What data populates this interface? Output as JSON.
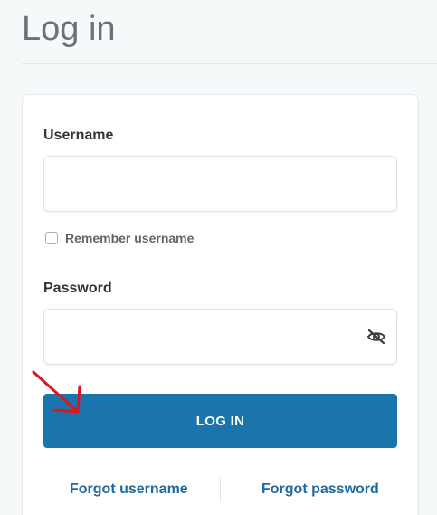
{
  "page": {
    "title": "Log in"
  },
  "form": {
    "username_label": "Username",
    "username_value": "",
    "remember_label": "Remember username",
    "remember_checked": false,
    "password_label": "Password",
    "password_value": "",
    "password_toggle_icon": "eye-slash-icon",
    "login_button_label": "LOG IN",
    "forgot_username_label": "Forgot username",
    "forgot_password_label": "Forgot password"
  },
  "annotation": {
    "icon": "red-arrow-icon",
    "color": "#e0141e"
  },
  "colors": {
    "accent": "#1b75ad",
    "link": "#1f6aa0",
    "title": "#6b7275",
    "background": "#f5f9fa"
  }
}
